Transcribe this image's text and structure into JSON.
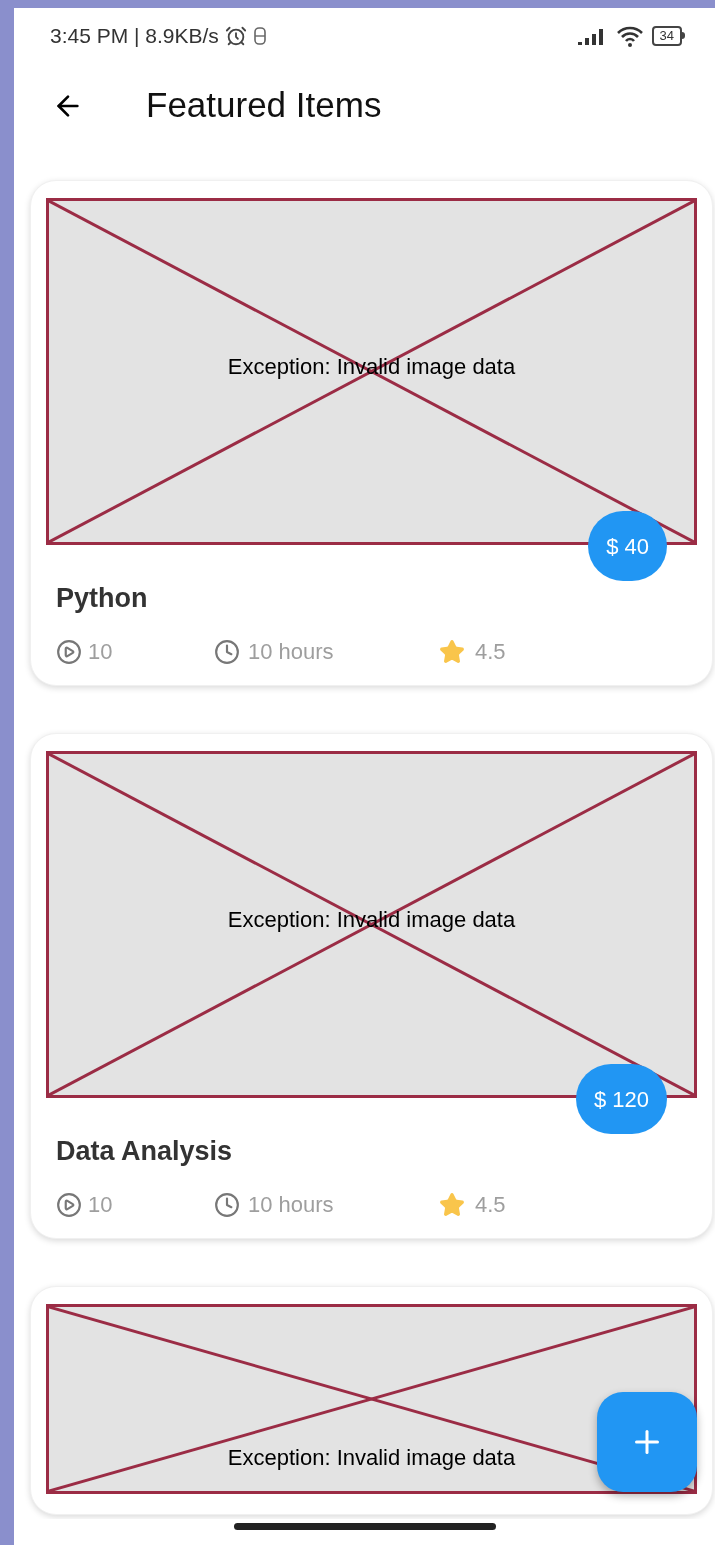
{
  "status_bar": {
    "time": "3:45 PM | 8.9KB/s",
    "battery": "34"
  },
  "header": {
    "title": "Featured Items"
  },
  "items": [
    {
      "image_error": "Exception: Invalid image data",
      "price": "$ 40",
      "title": "Python",
      "lessons": "10",
      "duration": "10 hours",
      "rating": "4.5"
    },
    {
      "image_error": "Exception: Invalid image data",
      "price": "$ 120",
      "title": "Data Analysis",
      "lessons": "10",
      "duration": "10 hours",
      "rating": "4.5"
    },
    {
      "image_error": "Exception: Invalid image data"
    }
  ]
}
